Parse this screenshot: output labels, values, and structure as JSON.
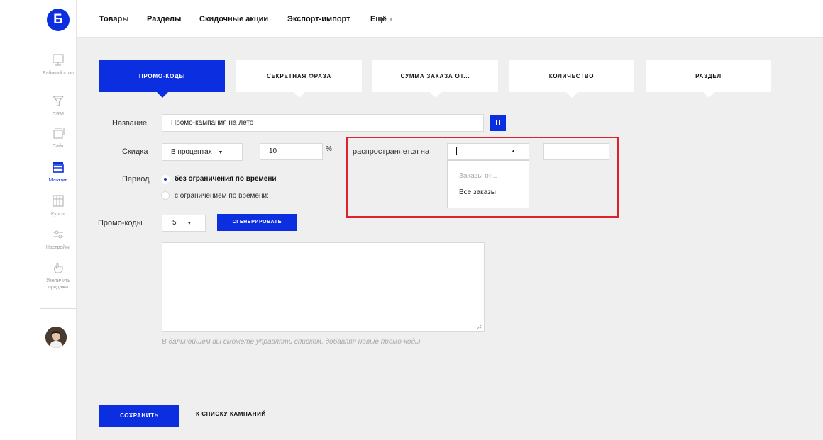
{
  "logo": {
    "letter": "Б"
  },
  "sidebar": {
    "items": [
      {
        "label": "Рабочий стол",
        "icon": "monitor-icon"
      },
      {
        "label": "CRM",
        "icon": "funnel-icon"
      },
      {
        "label": "Сайт",
        "icon": "pages-icon"
      },
      {
        "label": "Магазин",
        "icon": "store-icon",
        "active": true
      },
      {
        "label": "Курсы",
        "icon": "courses-icon"
      },
      {
        "label": "Настройки",
        "icon": "sliders-icon"
      },
      {
        "label": "Увеличить продажи",
        "icon": "hand-icon"
      }
    ],
    "avatar": "avatar"
  },
  "topnav": {
    "items": [
      "Товары",
      "Разделы",
      "Скидочные акции",
      "Экспорт-импорт"
    ],
    "more": "Ещё"
  },
  "tabs": [
    {
      "label": "ПРОМО-КОДЫ",
      "active": true
    },
    {
      "label": "СЕКРЕТНАЯ ФРАЗА"
    },
    {
      "label": "СУММА ЗАКАЗА ОТ..."
    },
    {
      "label": "КОЛИЧЕСТВО"
    },
    {
      "label": "РАЗДЕЛ"
    }
  ],
  "form": {
    "name_label": "Название",
    "name_value": "Промо-кампания на лето",
    "pause_icon": "pause-icon",
    "discount_label": "Скидка",
    "discount_type": "В процентах",
    "discount_value": "10",
    "percent_sign": "%",
    "applies_label": "распространяется на",
    "applies_dropdown_value": "",
    "applies_options": [
      "Заказы от...",
      "Все заказы"
    ],
    "period_label": "Период",
    "period_options": [
      {
        "label": "без ограничения по времени",
        "selected": true
      },
      {
        "label": "с ограничением по времени:",
        "selected": false
      }
    ],
    "promocodes_label": "Промо-коды",
    "promocodes_count": "5",
    "generate_button": "СГЕНЕРИРОВАТЬ",
    "hint": "В дальнейшем вы сможете управлять списком, добавляя новые промо-коды"
  },
  "footer": {
    "save_button": "СОХРАНИТЬ",
    "back_link": "К СПИСКУ КАМПАНИЙ"
  },
  "colors": {
    "accent": "#0a2ee0",
    "highlight": "#e0202a",
    "panel_bg": "#efefef"
  }
}
